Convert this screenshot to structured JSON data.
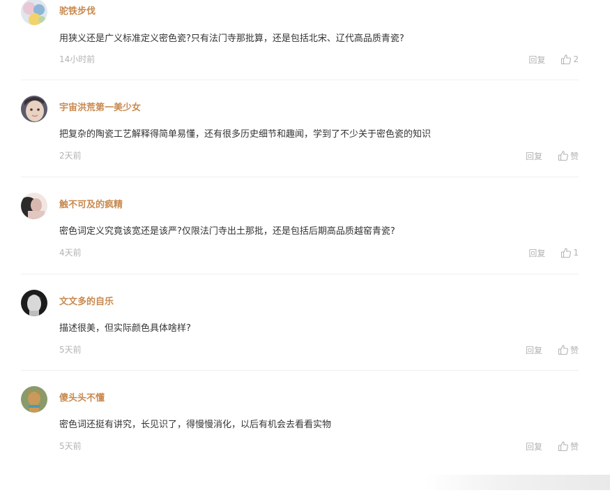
{
  "comments": [
    {
      "username": "驼铁步伐",
      "text": "用狭义还是广义标准定义密色瓷?只有法门寺那批算，还是包括北宋、辽代高品质青瓷?",
      "time": "14小时前",
      "reply_label": "回复",
      "like_label": "2",
      "avatar_colors": [
        "#e9c7d5",
        "#8fb6d6",
        "#f2d36b"
      ]
    },
    {
      "username": "宇宙洪荒第一美少女",
      "text": "把复杂的陶瓷工艺解释得简单易懂，还有很多历史细节和趣闻，学到了不少关于密色瓷的知识",
      "time": "2天前",
      "reply_label": "回复",
      "like_label": "赞",
      "avatar_colors": [
        "#c9a58c",
        "#4a4a5a",
        "#e8d2c2"
      ]
    },
    {
      "username": "触不可及的疯精",
      "text": "密色词定义究竟该宽还是该严?仅限法门寺出土那批，还是包括后期高品质越窑青瓷?",
      "time": "4天前",
      "reply_label": "回复",
      "like_label": "1",
      "avatar_colors": [
        "#d9b8b0",
        "#2b2b2b",
        "#f1e6e1"
      ]
    },
    {
      "username": "文文多的自乐",
      "text": "描述很美，但实际颜色具体啥样?",
      "time": "5天前",
      "reply_label": "回复",
      "like_label": "赞",
      "avatar_colors": [
        "#1c1c1c",
        "#d8d8d8",
        "#8a8a8a"
      ]
    },
    {
      "username": "傻头头不懂",
      "text": "密色词还挺有讲究，长见识了，得慢慢消化，以后有机会去看看实物",
      "time": "5天前",
      "reply_label": "回复",
      "like_label": "赞",
      "avatar_colors": [
        "#8a9a6a",
        "#c99a5a",
        "#4a9ab0"
      ]
    }
  ]
}
